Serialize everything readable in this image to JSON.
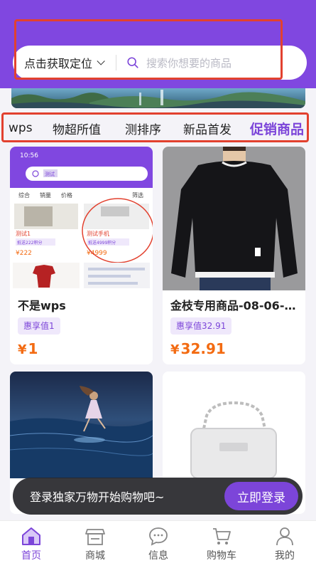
{
  "location": {
    "label": "点击获取定位"
  },
  "search": {
    "placeholder": "搜索你想要的商品"
  },
  "tabs": [
    "wps",
    "物超所值",
    "测排序",
    "新品首发",
    "促销商品"
  ],
  "active_tab": 4,
  "products": [
    {
      "title": "不是wps",
      "badge": "惠享值1",
      "currency": "¥",
      "price": "1"
    },
    {
      "title": "金枝专用商品-08-06-0...",
      "badge": "惠享值32.91",
      "currency": "¥",
      "price": "32.91"
    },
    {
      "title": "",
      "badge": "",
      "currency": "",
      "price": ""
    },
    {
      "title": "",
      "badge": "",
      "currency": "",
      "price": ""
    }
  ],
  "screenshot_card": {
    "time": "10:56",
    "search_text": "测试",
    "filters": [
      "综合",
      "销量",
      "价格",
      "筛选"
    ],
    "items": [
      {
        "name": "测试1",
        "badge": "抵送222积分",
        "price": "¥222"
      },
      {
        "name": "测试手机",
        "badge": "抵送4999积分",
        "price": "¥4999"
      }
    ]
  },
  "login_prompt": {
    "text": "登录独家万物开始购物吧~",
    "button": "立即登录"
  },
  "nav": [
    {
      "label": "首页",
      "icon": "home-icon"
    },
    {
      "label": "商城",
      "icon": "store-icon"
    },
    {
      "label": "信息",
      "icon": "message-icon"
    },
    {
      "label": "购物车",
      "icon": "cart-icon"
    },
    {
      "label": "我的",
      "icon": "profile-icon"
    }
  ],
  "colors": {
    "brand": "#8047e0",
    "accent": "#7c45d9",
    "price": "#f36b12",
    "highlight_box": "#e2412f"
  }
}
